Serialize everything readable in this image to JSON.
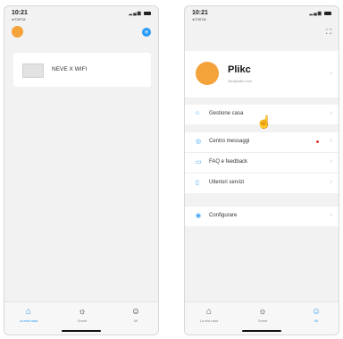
{
  "left_phone": {
    "time": "10:21",
    "back_label": "◂ Cerca",
    "device": {
      "name": "NEVE X WIFI"
    },
    "tabs": [
      {
        "label": "La mia casa",
        "icon": "home-icon"
      },
      {
        "label": "Smart",
        "icon": "sun-icon"
      },
      {
        "label": "Mi",
        "icon": "person-icon"
      }
    ]
  },
  "right_phone": {
    "time": "10:21",
    "back_label": "◂ Cerca",
    "profile": {
      "name": "Plikc",
      "email": "info@plikc.com"
    },
    "menu_group1": [
      {
        "label": "Gestione casa",
        "icon": "house-icon"
      }
    ],
    "menu_group2": [
      {
        "label": "Centro messaggi",
        "icon": "message-icon",
        "badge": true
      },
      {
        "label": "FAQ e feedback",
        "icon": "feedback-icon"
      },
      {
        "label": "Ulteriori servizi",
        "icon": "bookmark-icon"
      }
    ],
    "menu_group3": [
      {
        "label": "Configurare",
        "icon": "settings-icon"
      }
    ],
    "tabs": [
      {
        "label": "La mia casa",
        "icon": "home-icon"
      },
      {
        "label": "Smart",
        "icon": "sun-icon"
      },
      {
        "label": "Mi",
        "icon": "person-icon"
      }
    ]
  },
  "colors": {
    "accent": "#2b9bf4",
    "avatar": "#f4a23a",
    "badge": "#e53935"
  }
}
